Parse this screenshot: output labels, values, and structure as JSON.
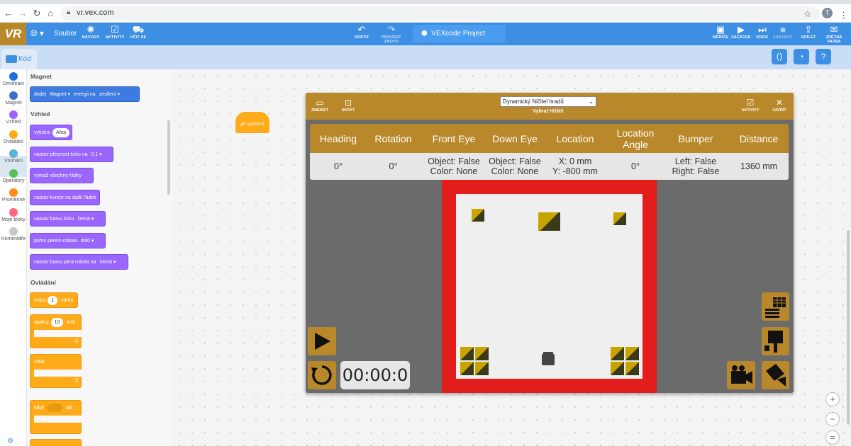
{
  "browser": {
    "url": "vr.vex.com",
    "profile_initial": "T",
    "icons": [
      "back-icon",
      "forward-icon",
      "reload-icon",
      "home-icon",
      "lock-icon",
      "star-icon",
      "menu-icon"
    ]
  },
  "header": {
    "logo": "VR",
    "file_menu": "Soubor",
    "tutorials": "NÁVODY",
    "activities": "AKTIVITY",
    "teach": "UČIT SE",
    "undo": "VRÁTIT",
    "redo": "PROVÉST ZNOVU",
    "project_name": "VEXcode Project",
    "monitor": "MĚŘIČE",
    "start": "ZAČÁTEK",
    "step": "KROK",
    "stop": "ZASTAVIT",
    "share": "SDÍLET",
    "feedback": "ZPĚTNÁ VAZBA",
    "accent": "#3d8fe4",
    "brand": "#b8882b"
  },
  "code_tab": {
    "label": "Kód"
  },
  "categories": [
    {
      "label": "Drivetrain",
      "color": "#1d6fe0"
    },
    {
      "label": "Magnet",
      "color": "#3a6fc9"
    },
    {
      "label": "Vzhled",
      "color": "#9966ff"
    },
    {
      "label": "Ovládání",
      "color": "#ffab19"
    },
    {
      "label": "Vnímání",
      "color": "#5cb1d6"
    },
    {
      "label": "Operátory",
      "color": "#59c059"
    },
    {
      "label": "Proměnné",
      "color": "#ff8c1a"
    },
    {
      "label": "Moje bloky",
      "color": "#ff6680"
    },
    {
      "label": "Komentáře",
      "color": "#c8c8c8"
    }
  ],
  "flyout": {
    "magnet_title": "Magnet",
    "magnet_block": {
      "t1": "dodej",
      "d1": "Magnet ▾",
      "t2": "energii na",
      "d2": "zesílení ▾"
    },
    "looks_title": "Vzhled",
    "print_block": {
      "t1": "vytiskni",
      "v": "Ahoj"
    },
    "precision_block": {
      "t1": "nastav přesnost tisku na",
      "d": "0.1 ▾"
    },
    "clear_block": "vymaž všechny řádky",
    "cursor_block": "nastav kurzor na další řádek",
    "color_block": {
      "t1": "nastav barvu tisku",
      "d": "černá ▾"
    },
    "pen_block": {
      "t1": "pohni perem robota",
      "d": "dolů ▾"
    },
    "pencolor_block": {
      "t1": "nastav barvu pera robota na",
      "d": "černá ▾"
    },
    "control_title": "Ovládání",
    "wait_block": {
      "t1": "čekej",
      "v": "1",
      "t2": "vteřin"
    },
    "repeat_block": {
      "t1": "opakuj",
      "v": "10",
      "t2": "krát"
    },
    "forever_block": "stále",
    "if_block": {
      "t1": "když",
      "t2": "tak"
    },
    "loop_arrow": "↺"
  },
  "workspace": {
    "hat_block": "při spuštění"
  },
  "playground": {
    "shrink": "ZMENŠIT",
    "hide": "SKRÝT",
    "selected_playground": "Dynamický Ničitel hradů",
    "select_label": "Vybrat Hřiště",
    "activities": "AKTIVITY",
    "close": "ZAVŘÍT",
    "headers": [
      "Heading",
      "Rotation",
      "Front Eye",
      "Down Eye",
      "Location",
      "Location Angle",
      "Bumper",
      "Distance"
    ],
    "values": [
      "0°",
      "0°",
      "Object: False\nColor: None",
      "Object: False\nColor: None",
      "X: 0 mm\nY: -800 mm",
      "0°",
      "Left: False\nRight: False",
      "1360 mm"
    ],
    "timer": "00:00:0",
    "wall_color": "#e31c1c",
    "tile_color": "#c9a400"
  },
  "zoom": {
    "in": "+",
    "out": "−",
    "reset": "="
  }
}
